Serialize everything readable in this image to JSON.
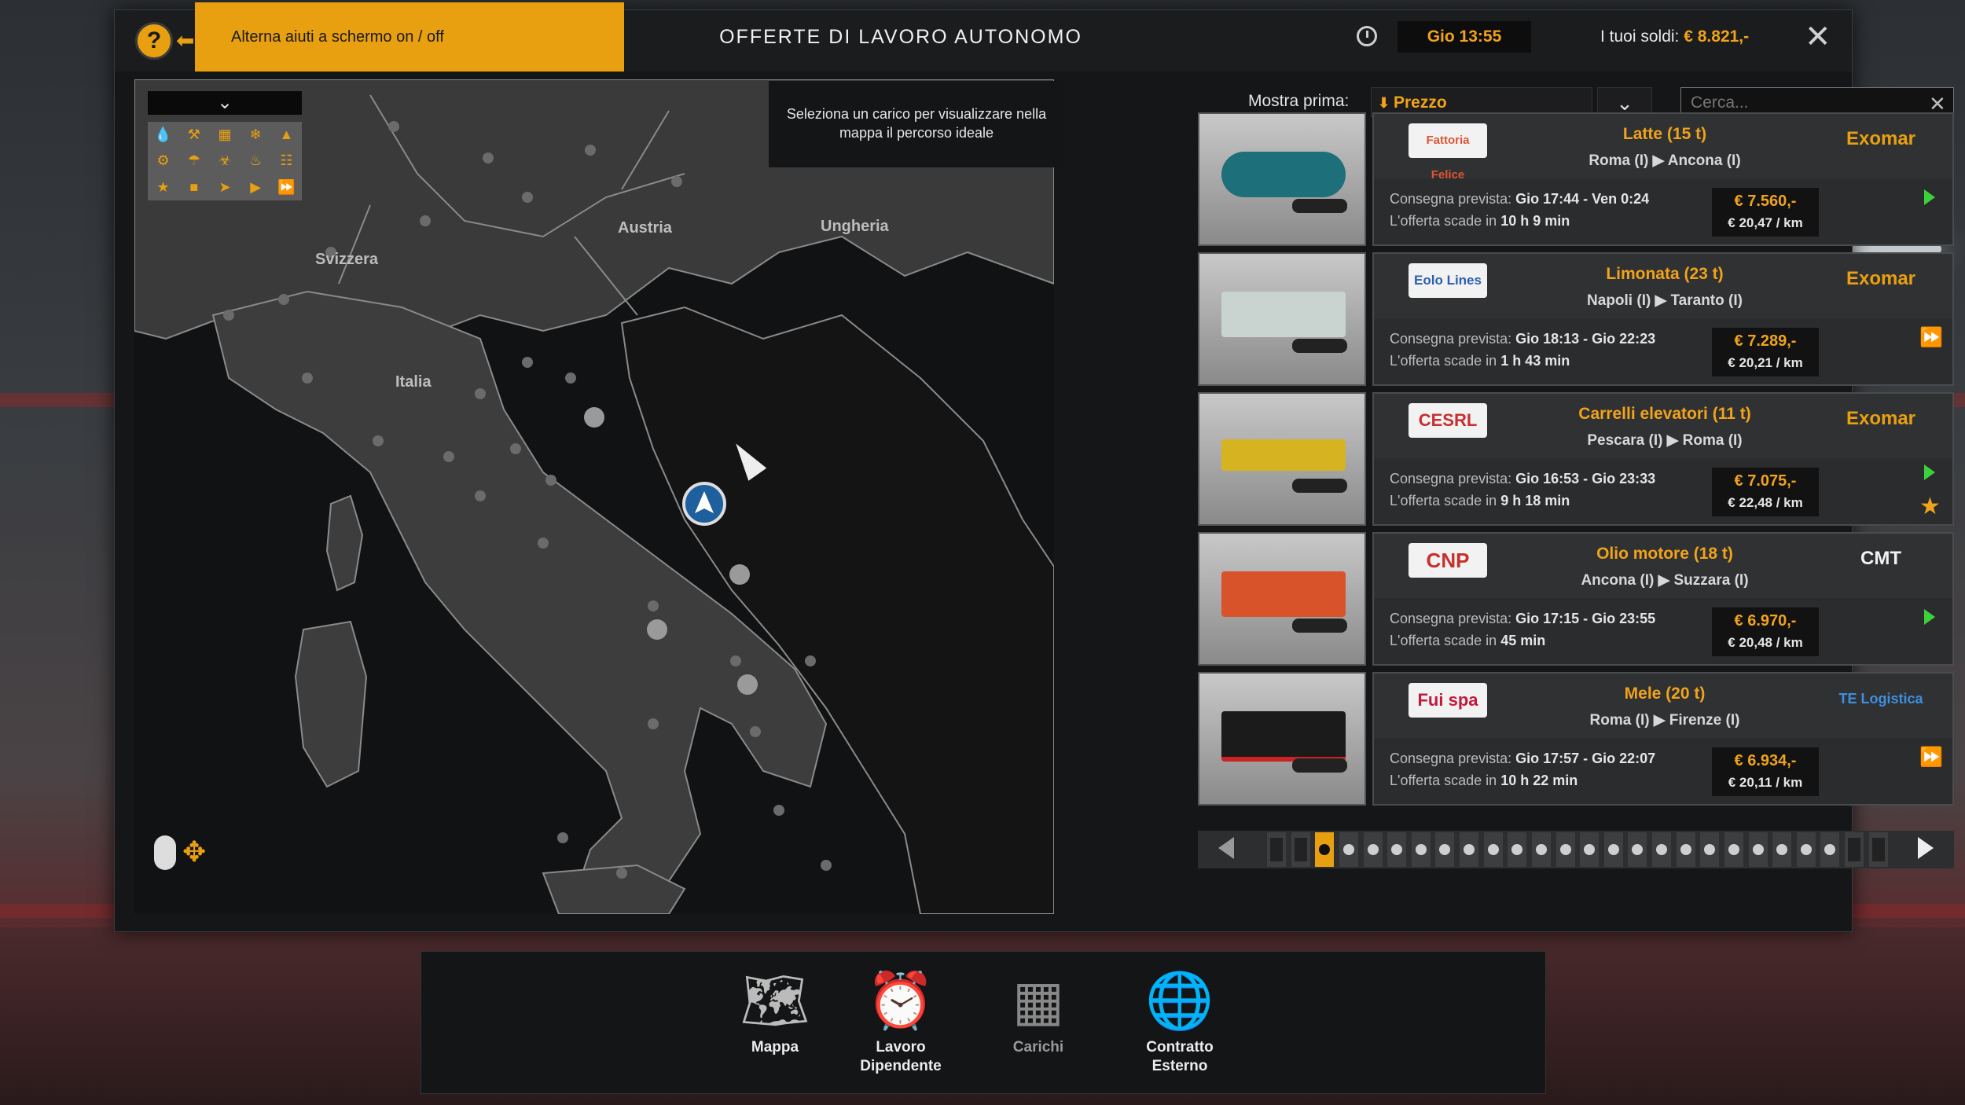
{
  "header": {
    "help_icon": "question-circle-icon",
    "tooltip": "Alterna aiuti a schermo on / off",
    "title": "OFFERTE DI LAVORO AUTONOMO",
    "time": "Gio 13:55",
    "money_label": "I tuoi soldi:",
    "money_value": "€ 8.821,-"
  },
  "map": {
    "hint": "Seleziona un carico per visualizzare nella mappa il percorso ideale",
    "countries": [
      "Svizzera",
      "Austria",
      "Ungheria",
      "Italia"
    ]
  },
  "sort": {
    "label": "Mostra prima:",
    "value": "Prezzo"
  },
  "search": {
    "placeholder": "Cerca..."
  },
  "jobs": [
    {
      "company_logo": "Fattoria Felice",
      "cargo": "Latte (15 t)",
      "route": "Roma (I)  ▶  Ancona (I)",
      "client_logo": "Exomar",
      "delivery_label": "Consegna prevista:",
      "delivery": "Gio 17:44 - Ven 0:24",
      "expire_label": "L'offerta scade in",
      "expire": "10 h 9 min",
      "price": "€ 7.560,-",
      "per_km": "€ 20,47 / km",
      "color": "#1d6f7a"
    },
    {
      "company_logo": "Eolo Lines",
      "cargo": "Limonata (23 t)",
      "route": "Napoli (I)  ▶  Taranto (I)",
      "client_logo": "Exomar",
      "delivery_label": "Consegna prevista:",
      "delivery": "Gio 18:13 - Gio 22:23",
      "expire_label": "L'offerta scade in",
      "expire": "1 h 43 min",
      "price": "€ 7.289,-",
      "per_km": "€ 20,21 / km",
      "color": "#c9d4d0"
    },
    {
      "company_logo": "CESRL",
      "cargo": "Carrelli elevatori (11 t)",
      "route": "Pescara (I)  ▶  Roma (I)",
      "client_logo": "Exomar",
      "delivery_label": "Consegna prevista:",
      "delivery": "Gio 16:53 - Gio 23:33",
      "expire_label": "L'offerta scade in",
      "expire": "9 h 18 min",
      "price": "€ 7.075,-",
      "per_km": "€ 22,48 / km",
      "color": "#d6b321"
    },
    {
      "company_logo": "CNP",
      "cargo": "Olio motore (18 t)",
      "route": "Ancona (I)  ▶  Suzzara (I)",
      "client_logo": "CMT",
      "delivery_label": "Consegna prevista:",
      "delivery": "Gio 17:15 - Gio 23:55",
      "expire_label": "L'offerta scade in",
      "expire": "45 min",
      "price": "€ 6.970,-",
      "per_km": "€ 20,48 / km",
      "color": "#d9532a"
    },
    {
      "company_logo": "Fui spa",
      "cargo": "Mele (20 t)",
      "route": "Roma (I)  ▶  Firenze (I)",
      "client_logo": "TE Logistica",
      "delivery_label": "Consegna prevista:",
      "delivery": "Gio 17:57 - Gio 22:07",
      "expire_label": "L'offerta scade in",
      "expire": "10 h 22 min",
      "price": "€ 6.934,-",
      "per_km": "€ 20,11 / km",
      "color": "#1b1b1b"
    }
  ],
  "dock": [
    {
      "label": "Mappa",
      "icon": "map-compass-icon"
    },
    {
      "label": "Lavoro Dipendente",
      "icon": "employment-clock-icon"
    },
    {
      "label": "Carichi",
      "icon": "cargo-icon"
    },
    {
      "label": "Contratto Esterno",
      "icon": "globe-contract-icon"
    }
  ],
  "colors": {
    "accent": "#f0a31b",
    "panel": "#151617"
  }
}
